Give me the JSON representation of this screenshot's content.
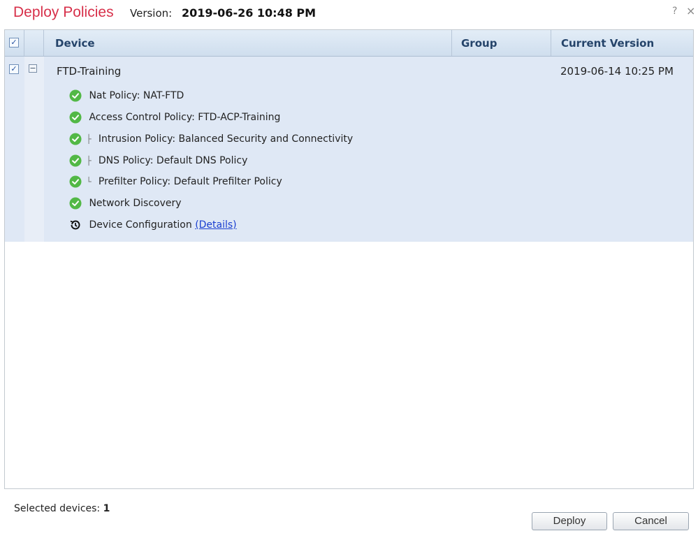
{
  "dialog": {
    "title": "Deploy Policies",
    "version_label": "Version:",
    "version_value": "2019-06-26 10:48 PM",
    "help_label": "?",
    "close_label": "×"
  },
  "table": {
    "columns": [
      "Device",
      "Group",
      "Current Version"
    ],
    "device": {
      "name": "FTD-Training",
      "group": "",
      "current_version": "2019-06-14 10:25 PM",
      "expander": "−",
      "items": [
        {
          "text": "Nat Policy: NAT-FTD",
          "status": "ok"
        },
        {
          "text": "Access Control Policy: FTD-ACP-Training",
          "status": "ok"
        },
        {
          "text": "Intrusion Policy: Balanced Security and Connectivity",
          "status": "ok"
        },
        {
          "text": "DNS Policy: Default DNS Policy",
          "status": "ok"
        },
        {
          "text": "Prefilter Policy: Default Prefilter Policy",
          "status": "ok"
        },
        {
          "text": "Network Discovery",
          "status": "ok"
        },
        {
          "text": "Device Configuration",
          "status": "pending",
          "link": "(Details)"
        }
      ]
    }
  },
  "footer": {
    "selected_label": "Selected devices:",
    "selected_count": "1",
    "deploy_label": "Deploy",
    "cancel_label": "Cancel"
  },
  "colors": {
    "title": "#d7304a",
    "header_bg": "#d6e3f1",
    "row_bg": "#dfe8f5",
    "ok": "#52b846",
    "link": "#1a3fd0"
  }
}
